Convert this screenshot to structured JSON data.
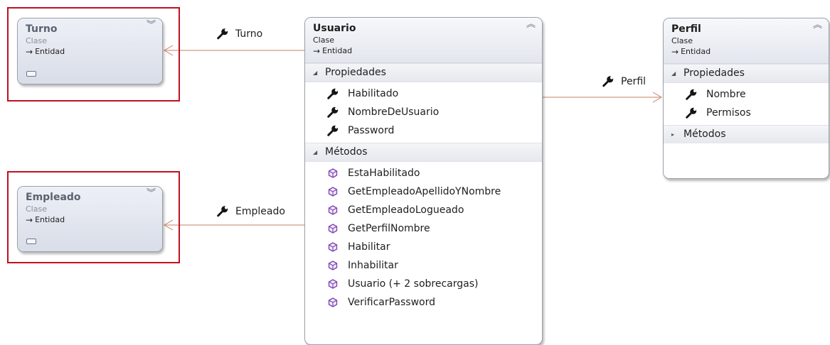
{
  "colors": {
    "association": "#d09a83",
    "highlight": "#c0101e",
    "method_icon": "#7a3fb0"
  },
  "classes": {
    "turno": {
      "name": "Turno",
      "stereotype": "Clase",
      "base": "Entidad",
      "toggle_icon": "chevron-double-down-icon"
    },
    "empleado": {
      "name": "Empleado",
      "stereotype": "Clase",
      "base": "Entidad",
      "toggle_icon": "chevron-double-down-icon"
    },
    "usuario": {
      "name": "Usuario",
      "stereotype": "Clase",
      "base": "Entidad",
      "toggle_icon": "chevron-double-up-icon",
      "properties_label": "Propiedades",
      "properties": [
        "Habilitado",
        "NombreDeUsuario",
        "Password"
      ],
      "methods_label": "Métodos",
      "methods": [
        "EstaHabilitado",
        "GetEmpleadoApellidoYNombre",
        "GetEmpleadoLogueado",
        "GetPerfilNombre",
        "Habilitar",
        "Inhabilitar",
        "Usuario (+ 2 sobrecargas)",
        "VerificarPassword"
      ]
    },
    "perfil": {
      "name": "Perfil",
      "stereotype": "Clase",
      "base": "Entidad",
      "toggle_icon": "chevron-double-up-icon",
      "properties_label": "Propiedades",
      "properties": [
        "Nombre",
        "Permisos"
      ],
      "methods_label": "Métodos",
      "methods_collapsed": true
    }
  },
  "associations": {
    "turno": "Turno",
    "empleado": "Empleado",
    "perfil": "Perfil"
  }
}
